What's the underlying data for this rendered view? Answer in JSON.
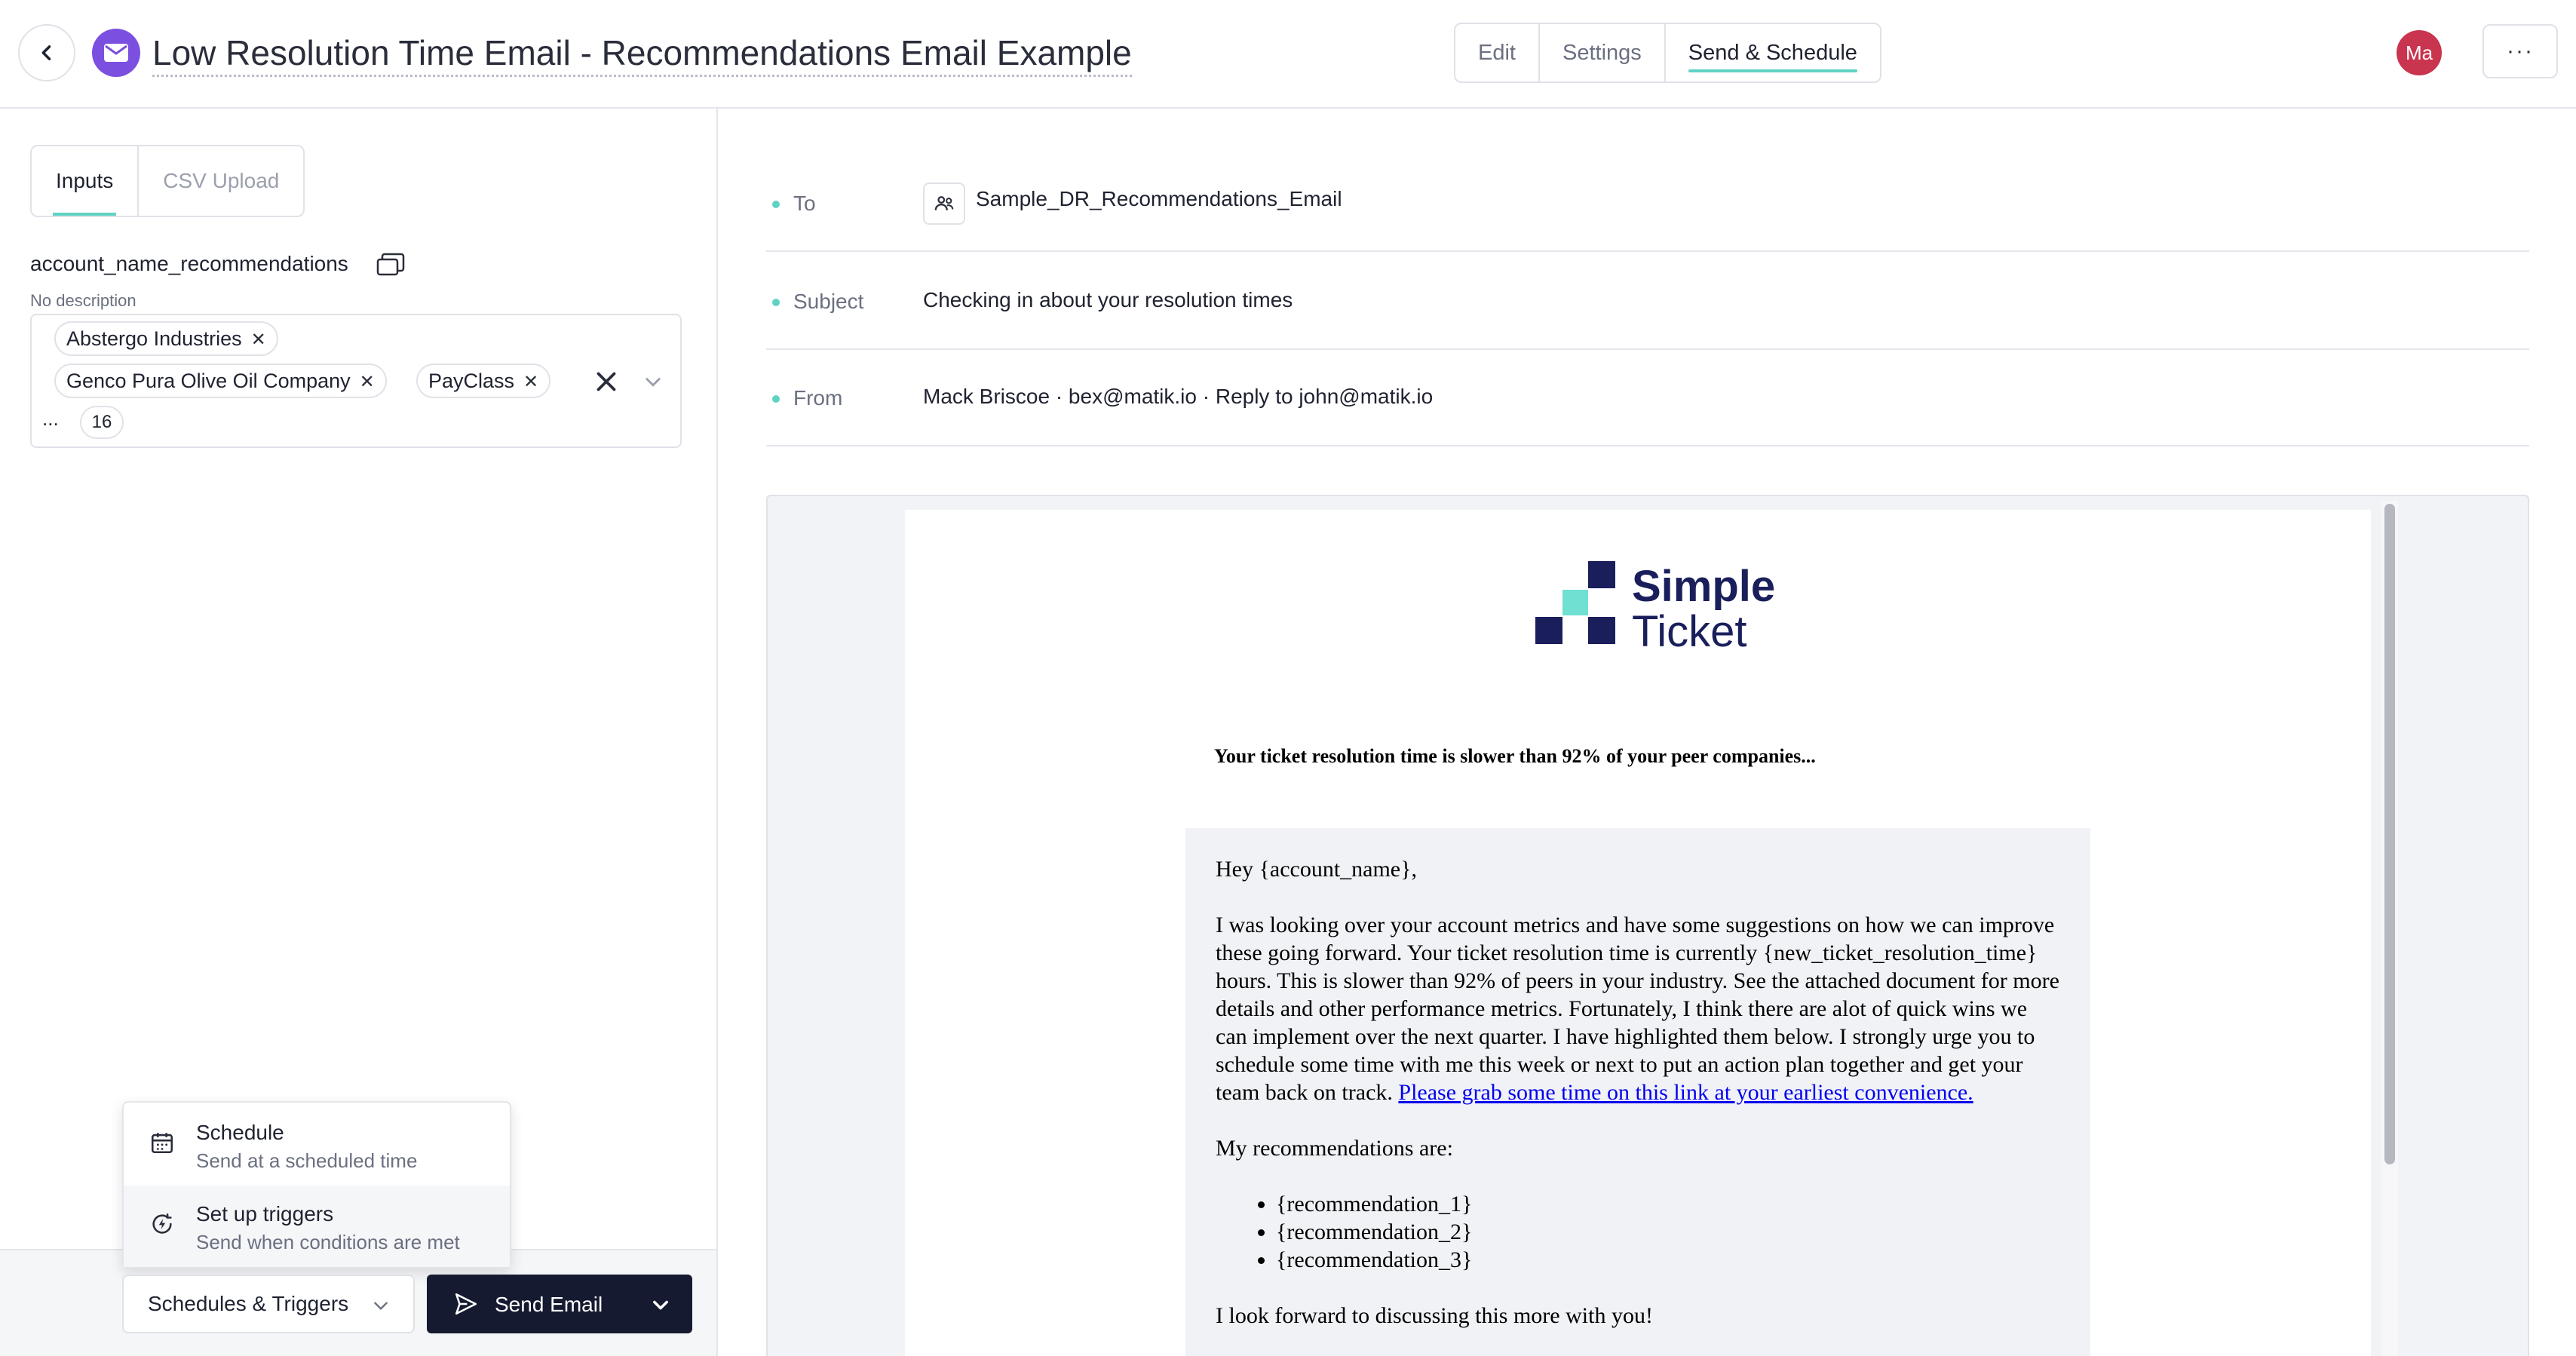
{
  "header": {
    "title": "Low Resolution Time Email - Recommendations Email Example",
    "tabs": [
      "Edit",
      "Settings",
      "Send & Schedule"
    ],
    "active_tab": "Send & Schedule",
    "avatar_initials": "Ma",
    "more_label": "···",
    "accent_color": "#5fd3c3",
    "template_icon_color": "#7b4fe0"
  },
  "left": {
    "tabs": [
      "Inputs",
      "CSV Upload"
    ],
    "field": {
      "label": "account_name_recommendations",
      "description": "No description",
      "chips": [
        "Abstergo Industries",
        "Genco Pura Olive Oil Company",
        "PayClass"
      ],
      "ellipsis": "...",
      "more_count": "16"
    },
    "dropdown": {
      "items": [
        {
          "title": "Schedule",
          "subtitle": "Send at a scheduled time",
          "icon": "calendar-icon"
        },
        {
          "title": "Set up triggers",
          "subtitle": "Send when conditions are met",
          "icon": "trigger-icon"
        }
      ]
    },
    "footer": {
      "schedules_label": "Schedules & Triggers",
      "send_label": "Send Email"
    }
  },
  "meta": {
    "to_label": "To",
    "to_value": "Sample_DR_Recommendations_Email",
    "subject_label": "Subject",
    "subject_value": "Checking in about your resolution times",
    "from_label": "From",
    "from_value": "Mack Briscoe · bex@matik.io · Reply to john@matik.io"
  },
  "email": {
    "logo_line1": "Simple",
    "logo_line2": "Ticket",
    "headline": "Your ticket resolution time is slower than 92% of your peer companies...",
    "greeting": "Hey {account_name},",
    "paragraph": "I was looking over your account metrics and have some suggestions on how we can improve these going forward. Your ticket resolution time is currently {new_ticket_resolution_time} hours. This is slower than 92% of peers in your industry. See the attached document for more details and other performance metrics. Fortunately, I think there are alot of quick wins we can implement over the next quarter. I have highlighted them below. I strongly urge you to schedule some time with me this week or next to put an action plan together and get your team back on track.",
    "link_text": "Please grab some time on this link at your earliest convenience.",
    "rec_intro": "My recommendations are:",
    "recommendations": [
      "{recommendation_1}",
      "{recommendation_2}",
      "{recommendation_3}"
    ],
    "closing": "I look forward to discussing this more with you!"
  }
}
